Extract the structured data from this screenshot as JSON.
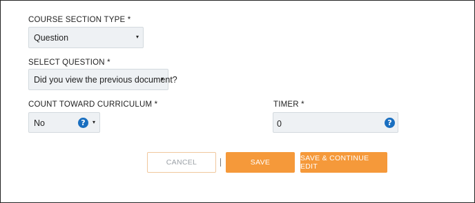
{
  "form": {
    "course_section_type": {
      "label": "COURSE SECTION TYPE *",
      "value": "Question"
    },
    "select_question": {
      "label": "SELECT QUESTION *",
      "value": "Did you view the previous document?"
    },
    "count_toward_curriculum": {
      "label": "COUNT TOWARD CURRICULUM *",
      "value": "No",
      "help_icon": "?"
    },
    "timer": {
      "label": "TIMER *",
      "value": "0",
      "help_icon": "?"
    },
    "caret": "▾"
  },
  "actions": {
    "cancel": "CANCEL",
    "separator": "|",
    "save": "SAVE",
    "save_continue": "SAVE & CONTINUE EDIT"
  },
  "colors": {
    "accent": "#f5993a",
    "help_icon": "#1a6fc0",
    "field_bg": "#eef1f4"
  }
}
